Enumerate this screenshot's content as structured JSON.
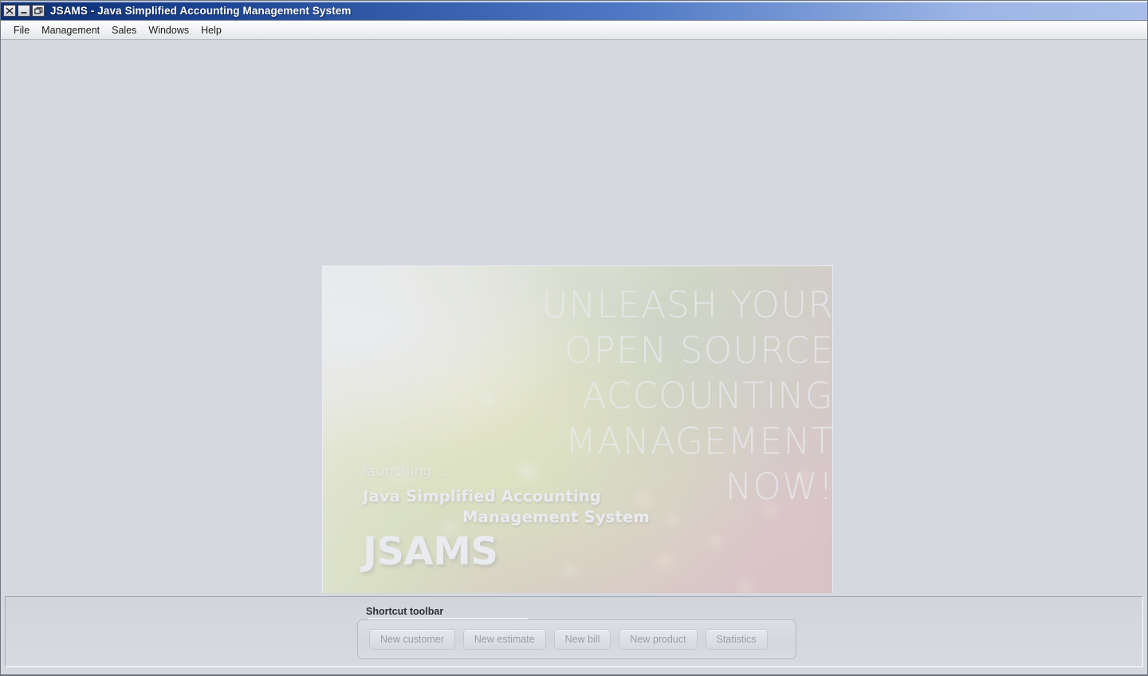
{
  "window": {
    "title": "JSAMS - Java Simplified Accounting Management System",
    "controls": [
      {
        "name": "close",
        "glyph": "✕"
      },
      {
        "name": "minimize",
        "glyph": "–"
      },
      {
        "name": "maximize",
        "glyph": "❐"
      }
    ]
  },
  "menubar": {
    "items": [
      {
        "label": "File"
      },
      {
        "label": "Management"
      },
      {
        "label": "Sales"
      },
      {
        "label": "Windows"
      },
      {
        "label": "Help"
      }
    ]
  },
  "splash": {
    "tagline": [
      "UNLEASH YOUR",
      "OPEN SOURCE",
      "ACCOUNTING",
      "MANAGEMENT",
      "NOW!"
    ],
    "launching": "launching ...",
    "product_line1": "Java Simplified Accounting",
    "product_line2": "Management System",
    "acronym": "JSAMS"
  },
  "shortcut_toolbar": {
    "title": "Shortcut toolbar",
    "buttons": [
      {
        "label": "New customer"
      },
      {
        "label": "New estimate"
      },
      {
        "label": "New bill"
      },
      {
        "label": "New product"
      },
      {
        "label": "Statistics"
      }
    ]
  },
  "colors": {
    "titlebar_dark": "#0e2f72",
    "titlebar_light": "#a8bee9",
    "desktop_bg": "#d5d8df",
    "menubar_bg": "#f3f4f6",
    "button_text": "#9a9da6"
  }
}
